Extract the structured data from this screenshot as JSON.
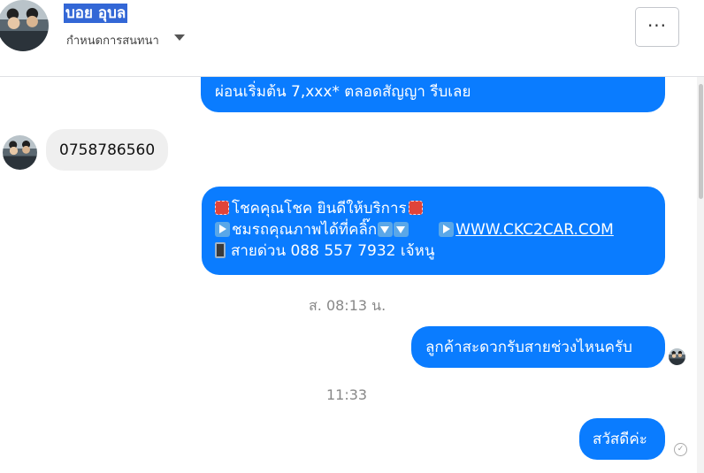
{
  "header": {
    "name": "บอย อุบล",
    "sub": "กำหนดการสนทนา",
    "more_label": "···"
  },
  "messages": {
    "m1_line": "ผ่อนเริ่มต้น 7,xxx* ตลอดสัญญา รีบเลย",
    "m2_text": "0758786560",
    "m3_line1": "โชคคุณโชค ยินดีให้บริการ",
    "m3_line2_text": "ชมรถคุณภาพได้ที่คลิ๊ก",
    "m3_link": "WWW.CKC2CAR.COM",
    "m3_line3": "สายด่วน 088 557 7932 เจ้หนู",
    "ts1": "ส. 08:13 น.",
    "m4_text": "ลูกค้าสะดวกรับสายช่วงไหนครับ",
    "ts2": "11:33",
    "m5_text": "สวัสดีค่ะ",
    "seen_mark": "✓"
  },
  "colors": {
    "outgoing_bubble": "#0a7cff",
    "incoming_bubble": "#efefef",
    "name_highlight": "#3367d6"
  },
  "icons": {
    "more": "ellipsis-icon",
    "caret": "caret-down-icon",
    "seen": "check-circle-icon"
  }
}
